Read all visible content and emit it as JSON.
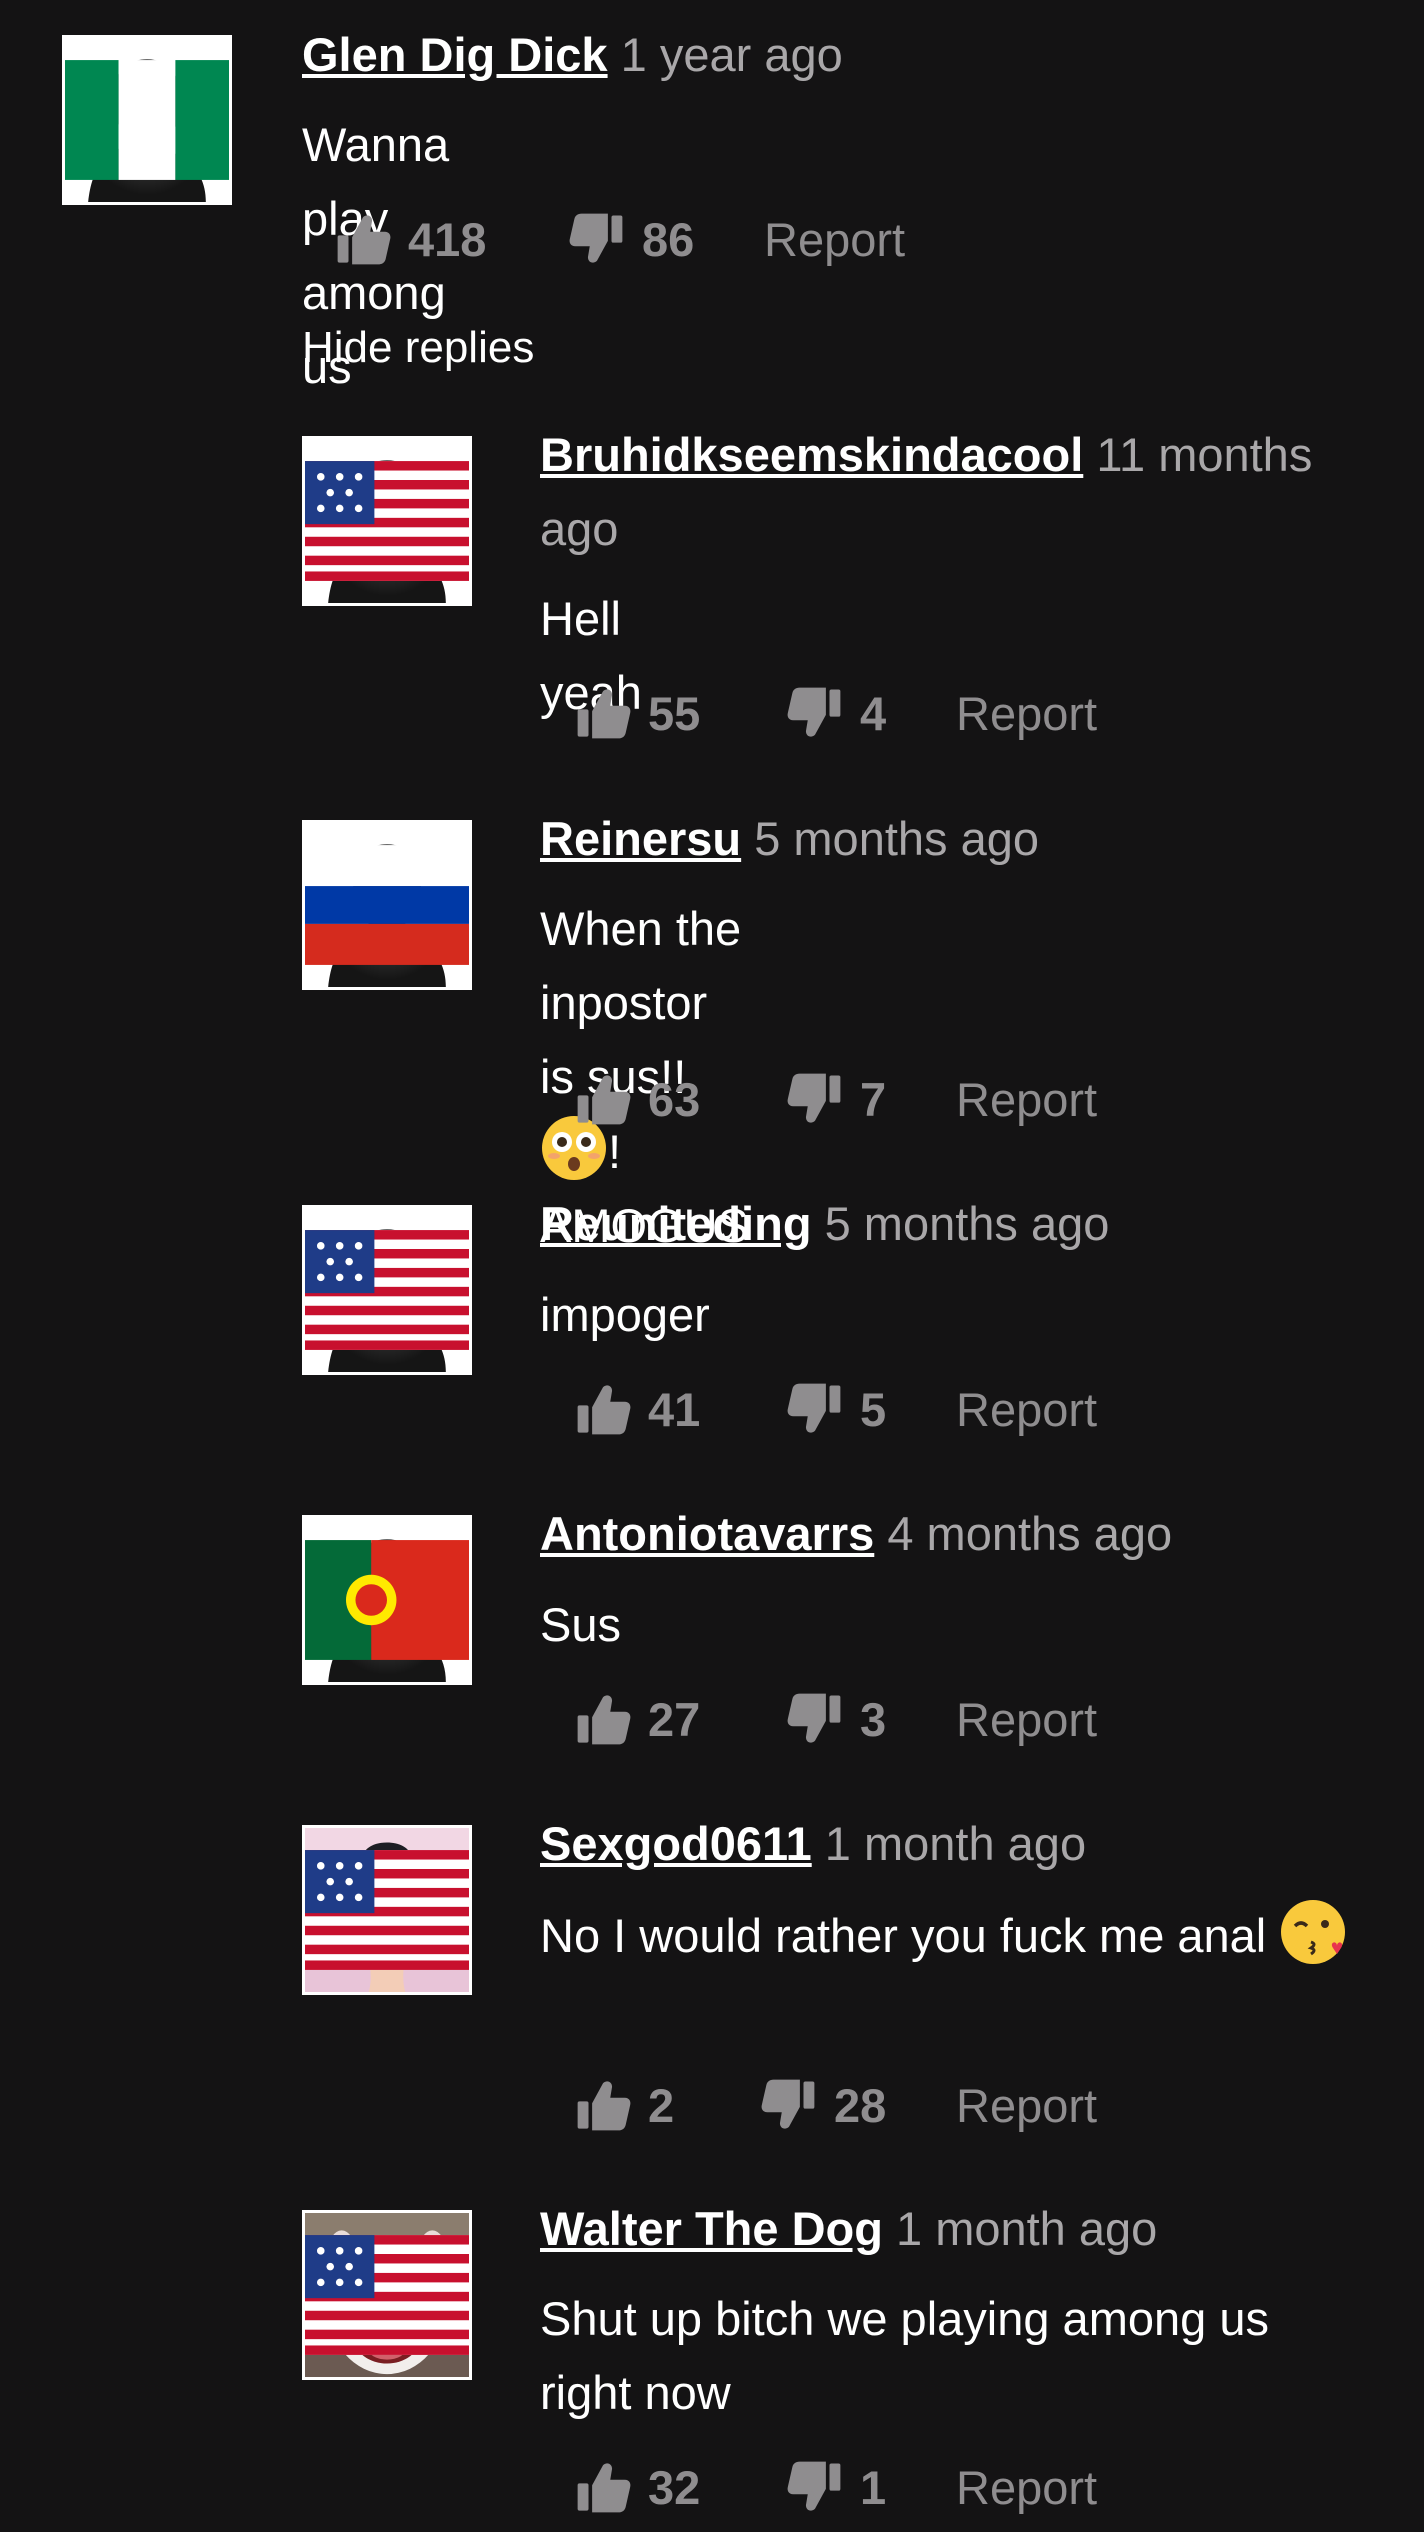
{
  "hide_replies_label": "Hide replies",
  "report_label": "Report",
  "main_comment": {
    "user": "Glen Dig Dick",
    "time": "1 year ago",
    "text": "Wanna play among us",
    "likes": "418",
    "dislikes": "86",
    "flag": "nigeria-flag-icon"
  },
  "replies": [
    {
      "user": "Bruhidkseemskindacool",
      "time": "11 months ago",
      "text": "Hell yeah",
      "likes": "55",
      "dislikes": "4",
      "flag": "usa-flag-icon"
    },
    {
      "user": "Reinersu",
      "time": "5 months ago",
      "text": "When the inpostor is sus!!",
      "text_after": "!",
      "text_line2": "AMOGUS",
      "emoji": "flushed-face-emoji",
      "likes": "63",
      "dislikes": "7",
      "flag": "russia-flag-icon"
    },
    {
      "user": "Reuniteding",
      "time": "5 months ago",
      "text": "impoger",
      "likes": "41",
      "dislikes": "5",
      "flag": "usa-flag-icon"
    },
    {
      "user": "Antoniotavarrs",
      "time": "4 months ago",
      "text": "Sus",
      "likes": "27",
      "dislikes": "3",
      "flag": "portugal-flag-icon"
    },
    {
      "user": "Sexgod0611",
      "time": "1 month ago",
      "text": "No I would rather you fuck me anal",
      "emoji": "kissing-face-emoji",
      "likes": "2",
      "dislikes": "28",
      "flag": "usa-flag-icon",
      "avatar": "anime-character-avatar"
    },
    {
      "user": "Walter The Dog",
      "time": "1 month ago",
      "text": "Shut up bitch we playing among us right now",
      "likes": "32",
      "dislikes": "1",
      "flag": "usa-flag-icon",
      "avatar": "dog-photo-avatar"
    }
  ],
  "colors": {
    "background": "#141314",
    "muted": "#8f8d8f",
    "time": "#a9a7a9"
  }
}
